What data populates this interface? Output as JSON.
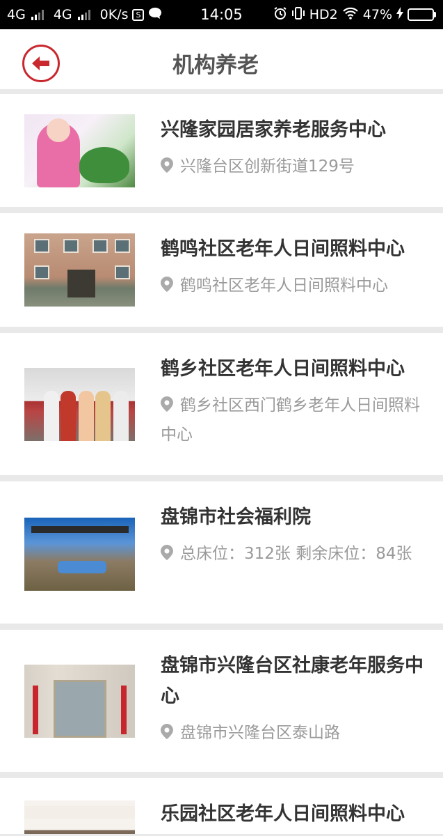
{
  "status_bar": {
    "net1": "4G",
    "net2": "4G",
    "speed": "0K/s",
    "time": "14:05",
    "hd": "HD2",
    "battery": "47%",
    "battery_level": 0.47
  },
  "header": {
    "back_icon": "back-arrow-icon",
    "title": "机构养老"
  },
  "institutions": [
    {
      "name": "兴隆家园居家养老服务中心",
      "address": "兴隆台区创新街道129号"
    },
    {
      "name": "鹤鸣社区老年人日间照料中心",
      "address": "鹤鸣社区老年人日间照料中心"
    },
    {
      "name": "鹤乡社区老年人日间照料中心",
      "address": "鹤乡社区西门鹤乡老年人日间照料中心"
    },
    {
      "name": "盘锦市社会福利院",
      "address": "总床位：312张 剩余床位：84张"
    },
    {
      "name": "盘锦市兴隆台区社康老年服务中心",
      "address": "盘锦市兴隆台区泰山路"
    },
    {
      "name": "乐园社区老年人日间照料中心",
      "address": ""
    }
  ],
  "colors": {
    "accent": "#c8282e",
    "title": "#555555",
    "name": "#333333",
    "address": "#9a9a9a",
    "divider": "#e9e9e9"
  }
}
